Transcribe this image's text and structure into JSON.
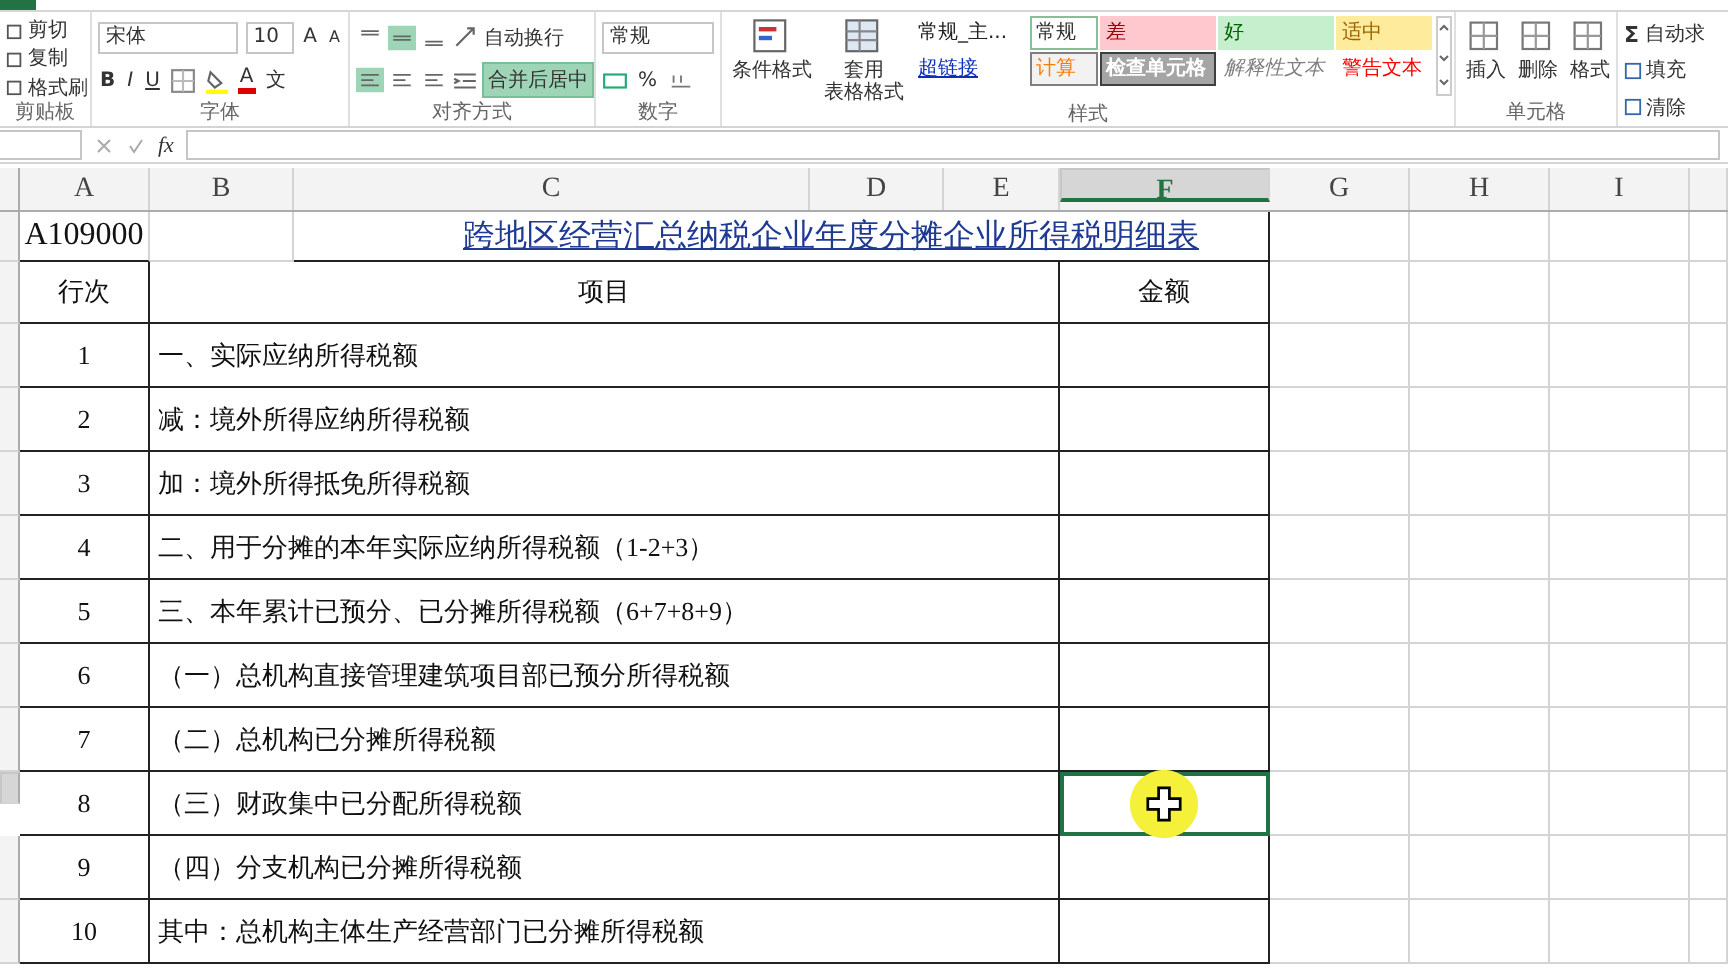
{
  "ribbon": {
    "clipboard": {
      "label": "剪贴板",
      "items": [
        "剪切",
        "复制",
        "格式刷"
      ]
    },
    "font": {
      "label": "字体",
      "family": "宋体",
      "size": "10",
      "grow": "A",
      "shrink": "A",
      "format_buttons": [
        "B",
        "I",
        "U"
      ],
      "color_glyph": "A",
      "phonetic": "文"
    },
    "alignment": {
      "label": "对齐方式",
      "vertical_buttons": [
        {
          "on": false
        },
        {
          "on": true
        },
        {
          "on": false
        }
      ],
      "horizontal_buttons": [
        {
          "on": true
        },
        {
          "on": false
        },
        {
          "on": false
        }
      ],
      "wrap": "自动换行",
      "merge": {
        "label": "合并后居中",
        "on": true
      }
    },
    "number": {
      "label": "数字",
      "format": "常规",
      "percent": "%"
    },
    "styles": {
      "label": "样式",
      "conditional": "条件格式",
      "table_format": [
        "套用",
        "表格格式"
      ],
      "cells": [
        {
          "text": "常规_主...",
          "kind": "plain"
        },
        {
          "text": "常规",
          "kind": "normal"
        },
        {
          "text": "差",
          "kind": "bad"
        },
        {
          "text": "好",
          "kind": "good"
        },
        {
          "text": "适中",
          "kind": "neutral"
        },
        {
          "text": "超链接",
          "kind": "link"
        },
        {
          "text": "计算",
          "kind": "calc"
        },
        {
          "text": "检查单元格",
          "kind": "check"
        },
        {
          "text": "解释性文本",
          "kind": "explain"
        },
        {
          "text": "警告文本",
          "kind": "warn"
        }
      ]
    },
    "cells": {
      "label": "单元格",
      "buttons": [
        "插入",
        "删除",
        "格式"
      ]
    },
    "editing": {
      "autosum_glyph": "Σ",
      "items": [
        "自动求",
        "填充",
        "清除"
      ]
    }
  },
  "formula_bar": {
    "fx": "fx"
  },
  "columns": [
    {
      "letter": "A",
      "selected": false
    },
    {
      "letter": "B",
      "selected": false
    },
    {
      "letter": "C",
      "selected": false
    },
    {
      "letter": "D",
      "selected": false
    },
    {
      "letter": "E",
      "selected": false
    },
    {
      "letter": "F",
      "selected": true
    },
    {
      "letter": "G",
      "selected": false
    },
    {
      "letter": "H",
      "selected": false
    },
    {
      "letter": "I",
      "selected": false
    }
  ],
  "sheet": {
    "code": "A109000",
    "title": "跨地区经营汇总纳税企业年度分摊企业所得税明细表",
    "headers": {
      "row": "行次",
      "item": "项目",
      "amount": "金额"
    },
    "rows": [
      {
        "row": "1",
        "item": "一、实际应纳所得税额",
        "selected": false
      },
      {
        "row": "2",
        "item": "减：境外所得应纳所得税额",
        "selected": false
      },
      {
        "row": "3",
        "item": "加：境外所得抵免所得税额",
        "selected": false
      },
      {
        "row": "4",
        "item": "二、用于分摊的本年实际应纳所得税额（1-2+3）",
        "selected": false
      },
      {
        "row": "5",
        "item": "三、本年累计已预分、已分摊所得税额（6+7+8+9）",
        "selected": false
      },
      {
        "row": "6",
        "item": "（一）总机构直接管理建筑项目部已预分所得税额",
        "selected": false
      },
      {
        "row": "7",
        "item": "（二）总机构已分摊所得税额",
        "selected": false
      },
      {
        "row": "8",
        "item": "（三）财政集中已分配所得税额",
        "selected": true
      },
      {
        "row": "9",
        "item": "（四）分支机构已分摊所得税额",
        "selected": false
      },
      {
        "row": "10",
        "item": "其中：总机构主体生产经营部门已分摊所得税额",
        "selected": false
      }
    ]
  }
}
